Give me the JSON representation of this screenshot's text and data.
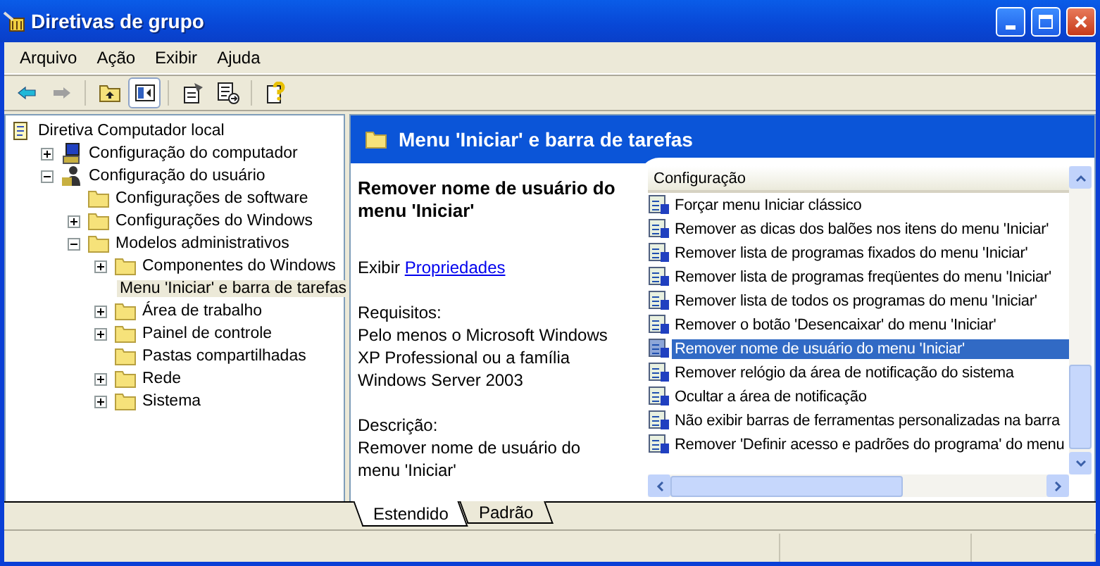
{
  "window": {
    "title": "Diretivas de grupo"
  },
  "menu": [
    "Arquivo",
    "Ação",
    "Exibir",
    "Ajuda"
  ],
  "toolbar": [
    {
      "kind": "back",
      "disabled": false,
      "pressed": false
    },
    {
      "kind": "forward",
      "disabled": true,
      "pressed": false
    },
    {
      "kind": "up",
      "pressed": false
    },
    {
      "kind": "tree",
      "pressed": true
    },
    {
      "kind": "properties",
      "pressed": false
    },
    {
      "kind": "export",
      "pressed": false
    },
    {
      "kind": "help",
      "pressed": false
    }
  ],
  "tree": [
    {
      "label": "Diretiva Computador local",
      "kind": "policy",
      "selected": false,
      "children": [
        {
          "label": "Configuração do computador",
          "kind": "computer",
          "expanded": false,
          "selected": false
        },
        {
          "label": "Configuração do usuário",
          "kind": "user",
          "expanded": true,
          "selected": false,
          "children": [
            {
              "label": "Configurações de software",
              "kind": "folder",
              "selected": false
            },
            {
              "label": "Configurações do Windows",
              "kind": "folder",
              "expanded": false,
              "selected": false
            },
            {
              "label": "Modelos administrativos",
              "kind": "folder",
              "expanded": true,
              "selected": false,
              "children": [
                {
                  "label": "Componentes do Windows",
                  "kind": "folder",
                  "expanded": false,
                  "selected": false
                },
                {
                  "label": "Menu 'Iniciar' e barra de tarefas",
                  "kind": "folder",
                  "selected": true
                },
                {
                  "label": "Área de trabalho",
                  "kind": "folder",
                  "expanded": false,
                  "selected": false
                },
                {
                  "label": "Painel de controle",
                  "kind": "folder",
                  "expanded": false,
                  "selected": false
                },
                {
                  "label": "Pastas compartilhadas",
                  "kind": "folder",
                  "selected": false
                },
                {
                  "label": "Rede",
                  "kind": "folder",
                  "expanded": false,
                  "selected": false
                },
                {
                  "label": "Sistema",
                  "kind": "folder",
                  "expanded": false,
                  "selected": false
                }
              ]
            }
          ]
        }
      ]
    }
  ],
  "header": {
    "title": "Menu 'Iniciar' e barra de tarefas"
  },
  "details": {
    "heading": "Remover nome de usuário do menu 'Iniciar'",
    "show_prefix": "Exibir",
    "link": "Propriedades",
    "requirements_label": "Requisitos:",
    "requirements": "Pelo menos o Microsoft Windows XP Professional ou a família Windows Server 2003",
    "description_label": "Descrição:",
    "description": "Remover nome de usuário do menu 'Iniciar'"
  },
  "list": {
    "column": "Configuração",
    "items": [
      {
        "label": "Forçar menu Iniciar clássico",
        "selected": false
      },
      {
        "label": "Remover as dicas dos balões nos itens do menu 'Iniciar'",
        "selected": false
      },
      {
        "label": "Remover lista de programas fixados do menu 'Iniciar'",
        "selected": false
      },
      {
        "label": "Remover lista de programas freqüentes do menu 'Iniciar'",
        "selected": false
      },
      {
        "label": "Remover lista de todos os programas do menu 'Iniciar'",
        "selected": false
      },
      {
        "label": "Remover o botão 'Desencaixar' do menu 'Iniciar'",
        "selected": false
      },
      {
        "label": "Remover nome de usuário do menu 'Iniciar'",
        "selected": true
      },
      {
        "label": "Remover relógio da área de notificação do sistema",
        "selected": false
      },
      {
        "label": "Ocultar a área de notificação",
        "selected": false
      },
      {
        "label": "Não exibir barras de ferramentas personalizadas na barra",
        "selected": false
      },
      {
        "label": "Remover 'Definir acesso e padrões do programa' do menu",
        "selected": false
      }
    ]
  },
  "tabs": [
    {
      "label": "Estendido",
      "selected": true
    },
    {
      "label": "Padrão",
      "selected": false
    }
  ]
}
